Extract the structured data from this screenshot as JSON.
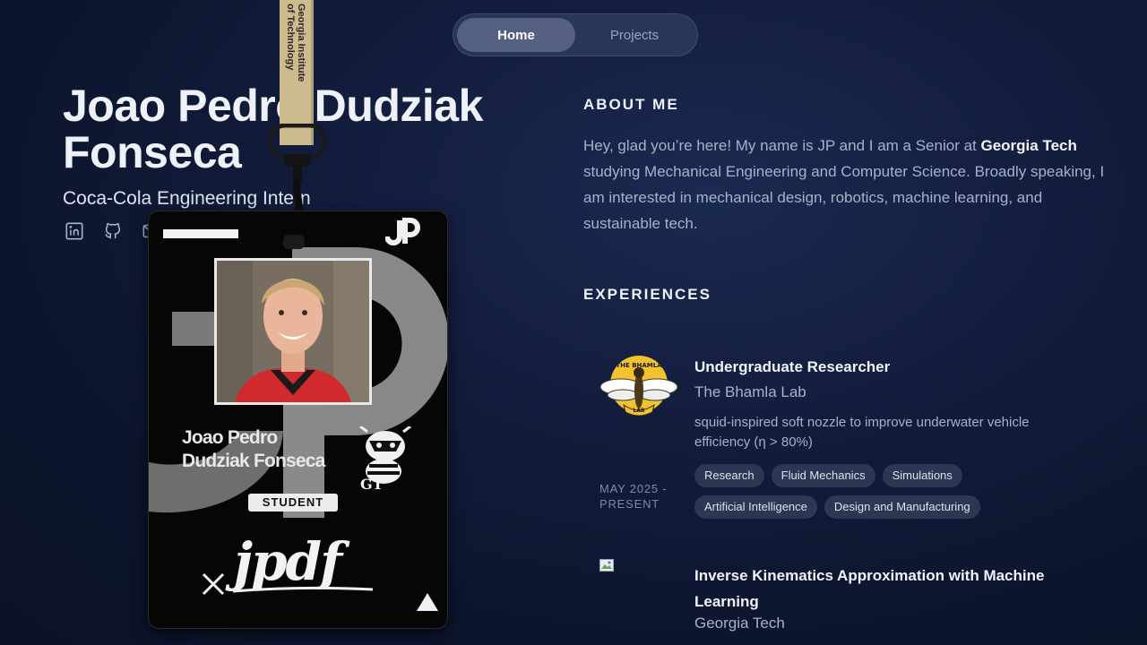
{
  "nav": {
    "items": [
      {
        "label": "Home",
        "active": true
      },
      {
        "label": "Projects",
        "active": false
      }
    ]
  },
  "profile": {
    "name": "Joao Pedro Dudziak Fonseca",
    "role": "Coca-Cola Engineering Intern",
    "socials": [
      "linkedin-icon",
      "github-icon",
      "mail-icon"
    ]
  },
  "lanyard": {
    "text": "Georgia Institute\nof Technology"
  },
  "badge": {
    "monogram": "JP",
    "name_line1": "Joao Pedro",
    "name_line2": "Dudziak Fonseca",
    "label": "STUDENT",
    "signature": "jpdf"
  },
  "about": {
    "heading": "ABOUT ME",
    "text_before": "Hey, glad you’re here! My name is JP and I am a Senior at ",
    "text_bold": "Georgia Tech",
    "text_after": " studying Mechanical Engineering and Computer Science. Broadly speaking, I am interested in mechanical design, robotics, machine learning, and sustainable tech."
  },
  "experiences": {
    "heading": "EXPERIENCES",
    "items": [
      {
        "title": "Undergraduate Researcher",
        "org": "The Bhamla Lab",
        "logo_text_top": "THE BHAMLA",
        "logo_text_bottom": "LAB",
        "description": "squid-inspired soft nozzle to improve underwater vehicle efficiency (η > 80%)",
        "date_line1": "MAY 2025 -",
        "date_line2": "PRESENT",
        "tags": [
          "Research",
          "Fluid Mechanics",
          "Simulations",
          "Artificial Intelligence",
          "Design and Manufacturing"
        ]
      },
      {
        "title": "Inverse Kinematics Approximation with Machine Learning",
        "org": "Georgia Tech"
      }
    ]
  },
  "colors": {
    "background": "#0d152e",
    "tag_bg": "#2c3754",
    "muted_text": "#a7b1c8",
    "lanyard": "#cdbb8e"
  }
}
